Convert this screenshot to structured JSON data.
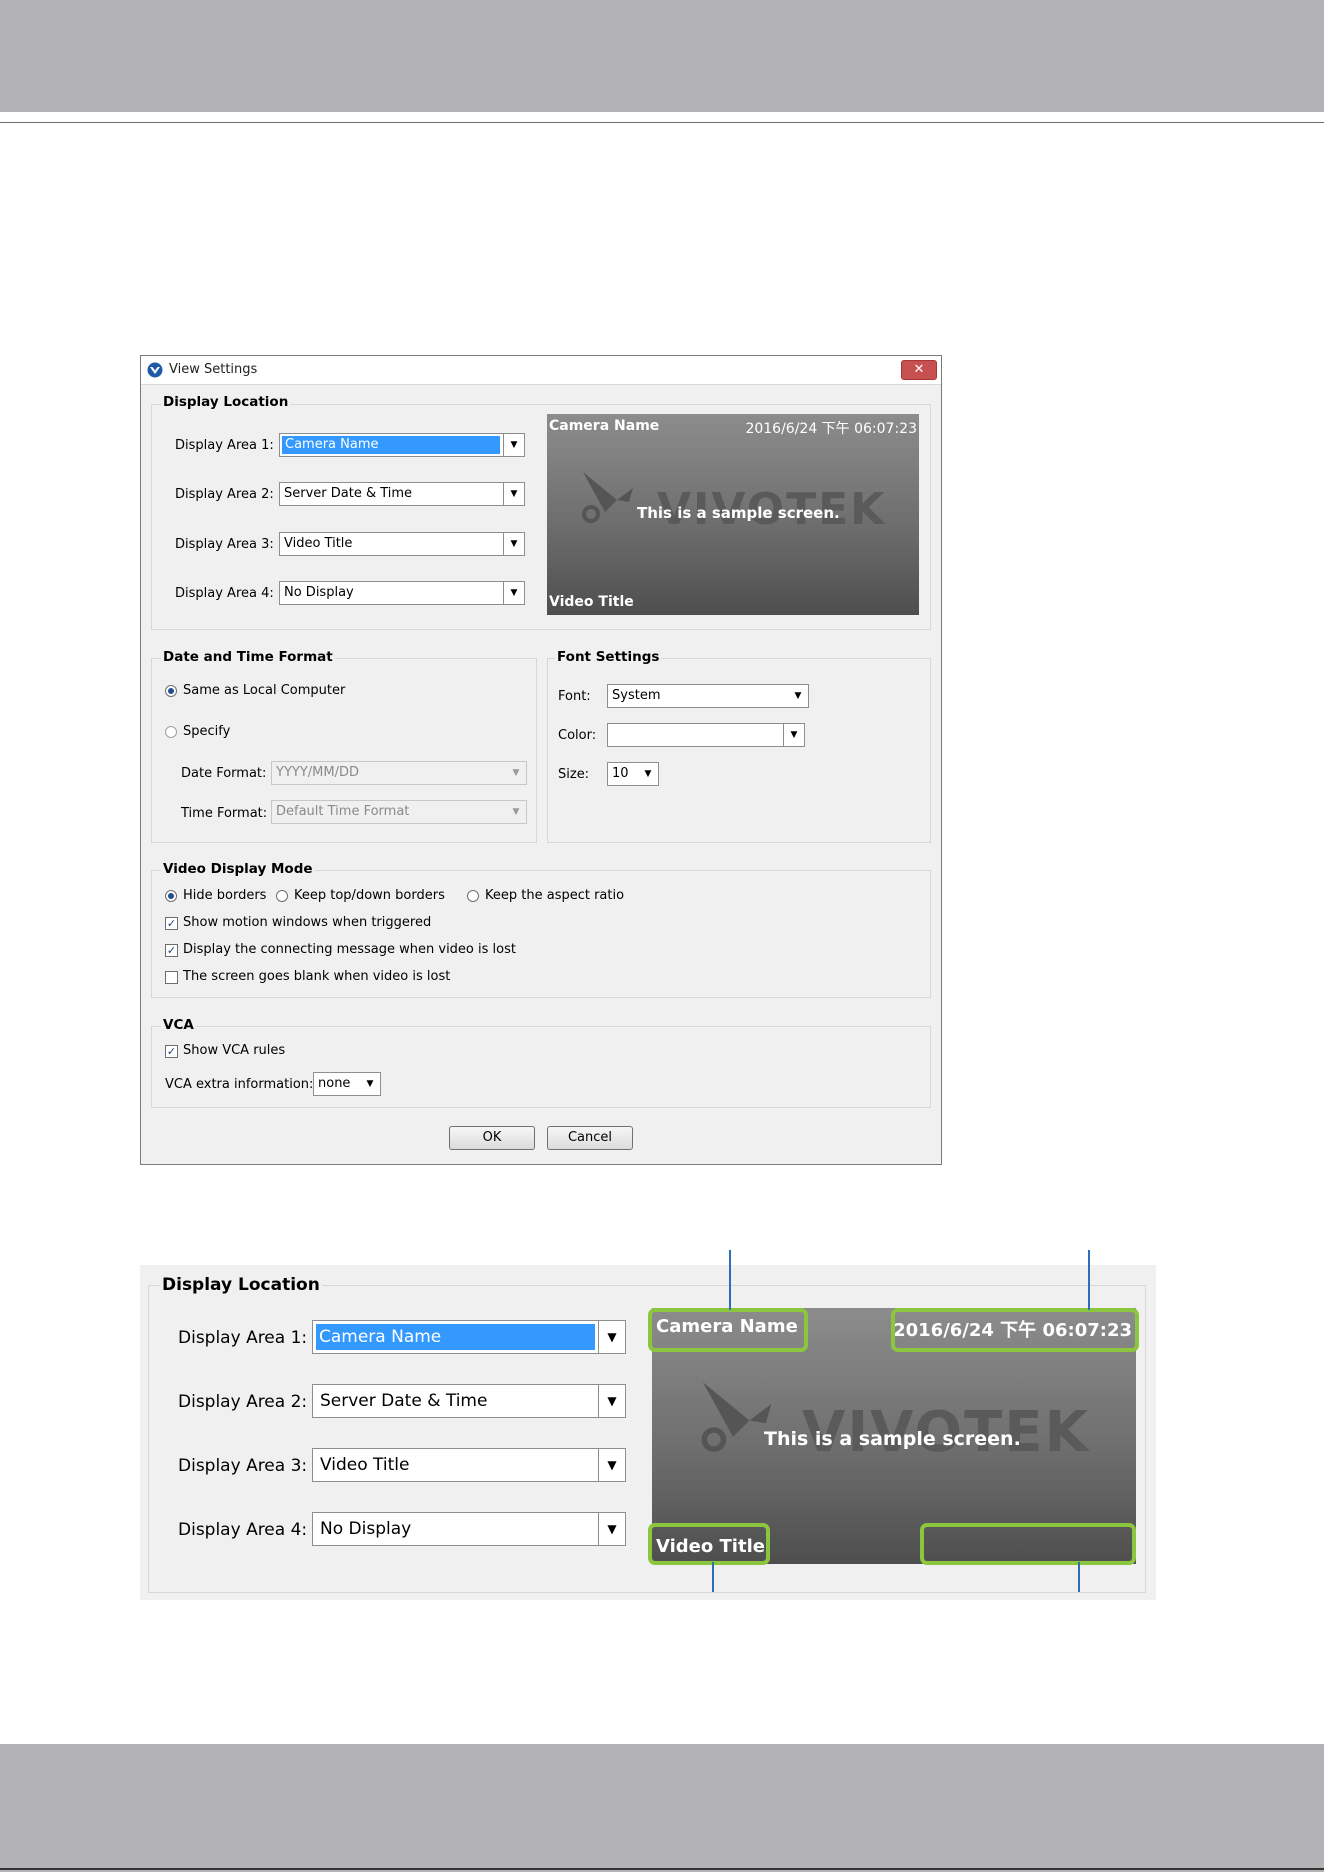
{
  "dialog": {
    "title": "View Settings",
    "close_glyph": "✕",
    "display_location": {
      "title": "Display Location",
      "areas": [
        {
          "label": "Display Area 1:",
          "value": "Camera Name"
        },
        {
          "label": "Display Area 2:",
          "value": "Server Date & Time"
        },
        {
          "label": "Display Area 3:",
          "value": "Video Title"
        },
        {
          "label": "Display Area 4:",
          "value": "No Display"
        }
      ],
      "preview": {
        "camera_name": "Camera Name",
        "datetime": "2016/6/24 下午 06:07:23",
        "sample": "This is a sample screen.",
        "video_title": "Video Title",
        "watermark": "VIVOTEK"
      }
    },
    "date_time": {
      "title": "Date and Time Format",
      "same_as_local": "Same as Local Computer",
      "specify": "Specify",
      "date_label": "Date Format:",
      "date_value": "YYYY/MM/DD",
      "time_label": "Time Format:",
      "time_value": "Default Time Format"
    },
    "font": {
      "title": "Font Settings",
      "font_label": "Font:",
      "font_value": "System",
      "color_label": "Color:",
      "color_value": "",
      "size_label": "Size:",
      "size_value": "10"
    },
    "video_mode": {
      "title": "Video Display Mode",
      "hide_borders": "Hide borders",
      "keep_top_down": "Keep top/down borders",
      "keep_aspect": "Keep the aspect ratio",
      "show_motion": "Show motion windows when triggered",
      "display_connecting": "Display the connecting message when video is lost",
      "screen_blank": "The screen goes blank when video is lost"
    },
    "vca": {
      "title": "VCA",
      "show_rules": "Show VCA rules",
      "extra_label": "VCA extra information:",
      "extra_value": "none"
    },
    "ok": "OK",
    "cancel": "Cancel"
  },
  "zoom": {
    "title": "Display Location",
    "areas": [
      {
        "label": "Display Area 1:",
        "value": "Camera Name"
      },
      {
        "label": "Display Area 2:",
        "value": "Server Date & Time"
      },
      {
        "label": "Display Area 3:",
        "value": "Video Title"
      },
      {
        "label": "Display Area 4:",
        "value": "No Display"
      }
    ],
    "preview": {
      "camera_name": "Camera Name",
      "datetime": "2016/6/24 下午 06:07:23",
      "sample": "This is a sample screen.",
      "video_title": "Video Title",
      "watermark": "VIVOTEK"
    }
  },
  "colors": {
    "callout_green": "#8cc63f",
    "pointer_blue": "#2b6fb6",
    "selection_blue": "#3399ff",
    "header_gray": "#b3b3b5"
  }
}
